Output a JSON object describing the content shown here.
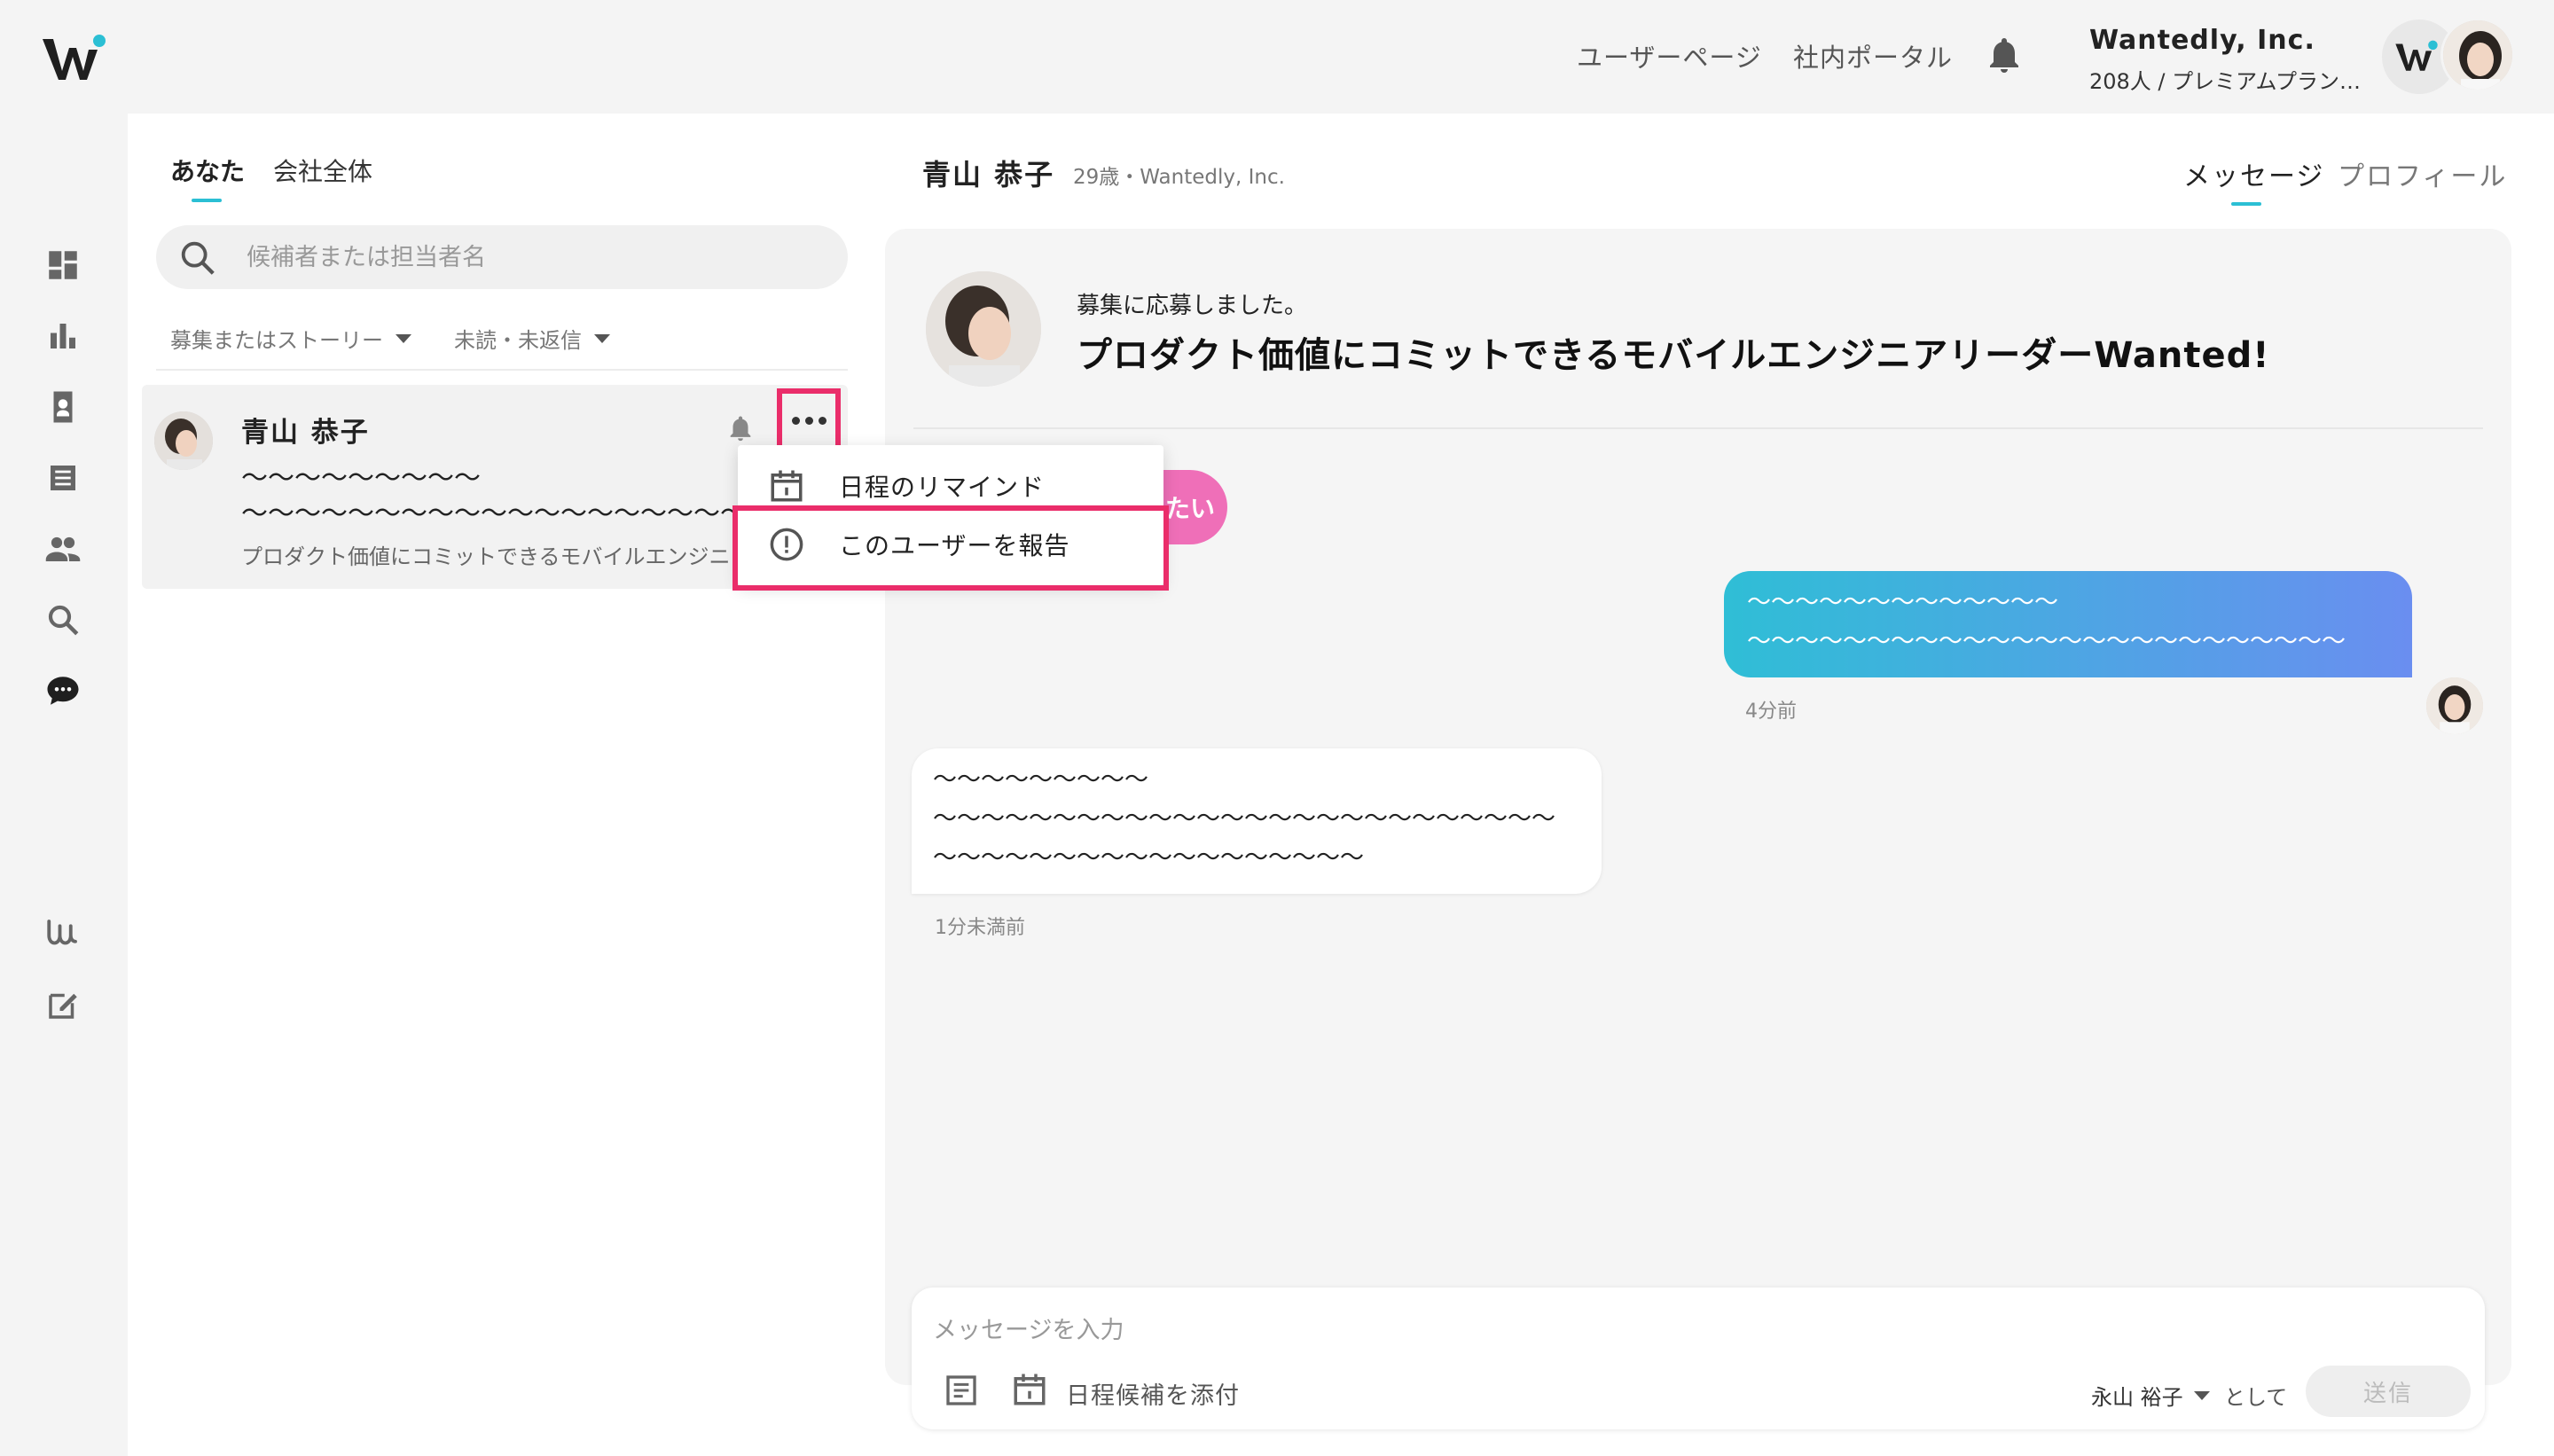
{
  "header": {
    "user_page": "ユーザーページ",
    "portal": "社内ポータル",
    "company_name": "Wantedly, Inc.",
    "company_sub": "208人 / プレミアムプラン ..."
  },
  "list": {
    "tabs": [
      "あなた",
      "会社全体"
    ],
    "search_placeholder": "候補者または担当者名",
    "filter_story": "募集またはストーリー",
    "filter_status": "未読・未返信",
    "item": {
      "name": "青山 恭子",
      "line1": "〜〜〜〜〜〜〜〜〜",
      "line2": "〜〜〜〜〜〜〜〜〜〜〜〜〜〜〜〜〜〜〜...",
      "sub": "プロダクト価値にコミットできるモバイルエンジニア"
    }
  },
  "dropdown": {
    "remind": "日程のリマインド",
    "report": "このユーザーを報告"
  },
  "thread": {
    "name": "青山 恭子",
    "meta": "29歳・Wantedly, Inc.",
    "tab_message": "メッセージ",
    "tab_profile": "プロフィール",
    "applied": "募集に応募しました。",
    "job_title": "プロダクト価値にコミットできるモバイルエンジニアリーダーWanted!",
    "chip_text": "たい",
    "out_line1": "〜〜〜〜〜〜〜〜〜〜〜〜〜",
    "out_line2": "〜〜〜〜〜〜〜〜〜〜〜〜〜〜〜〜〜〜〜〜〜〜〜〜〜",
    "out_time": "4分前",
    "in_line1": "〜〜〜〜〜〜〜〜〜",
    "in_line2": "〜〜〜〜〜〜〜〜〜〜〜〜〜〜〜〜〜〜〜〜〜〜〜〜〜〜",
    "in_line3": "〜〜〜〜〜〜〜〜〜〜〜〜〜〜〜〜〜〜",
    "in_time": "1分未満前"
  },
  "composer": {
    "placeholder": "メッセージを入力",
    "attach": "日程候補を添付",
    "sender": "永山 裕子",
    "as": "として",
    "send": "送信"
  },
  "colors": {
    "accent": "#2bbfd4",
    "highlight": "#ea2d6a",
    "chip": "#ef6fb8"
  }
}
